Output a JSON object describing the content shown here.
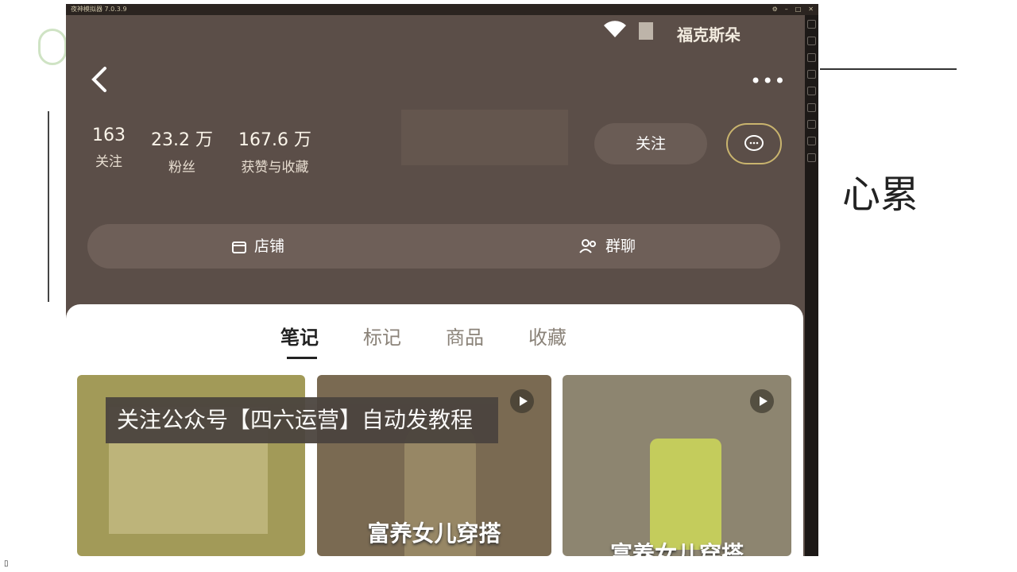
{
  "emulator": {
    "title": "夜神模拟器 7.0.3.9",
    "controls": [
      "settings-icon",
      "minimize-icon",
      "maximize-icon",
      "close-icon"
    ]
  },
  "whiteboard": {
    "notes": "心累"
  },
  "status_bar": {
    "carrier": "福克斯朵"
  },
  "profile": {
    "stats": [
      {
        "value": "163",
        "label": "关注"
      },
      {
        "value": "23.2 万",
        "label": "粉丝"
      },
      {
        "value": "167.6 万",
        "label": "获赞与收藏"
      }
    ],
    "follow_label": "关注",
    "shop_label": "店铺",
    "group_label": "群聊"
  },
  "tabs": [
    {
      "label": "笔记",
      "active": true
    },
    {
      "label": "标记",
      "active": false
    },
    {
      "label": "商品",
      "active": false
    },
    {
      "label": "收藏",
      "active": false
    }
  ],
  "cards": [
    {
      "caption": "",
      "has_play": false
    },
    {
      "caption": "富养女儿穿搭",
      "has_play": true
    },
    {
      "caption": "富养女儿穿搭",
      "has_play": true
    }
  ],
  "overlay_text": "关注公众号【四六运营】自动发教程",
  "colors": {
    "header_bg": "#5b4e48",
    "button_bg": "#6a5c55",
    "accent_ring": "#c9b46e",
    "content_bg": "#ffffff"
  }
}
